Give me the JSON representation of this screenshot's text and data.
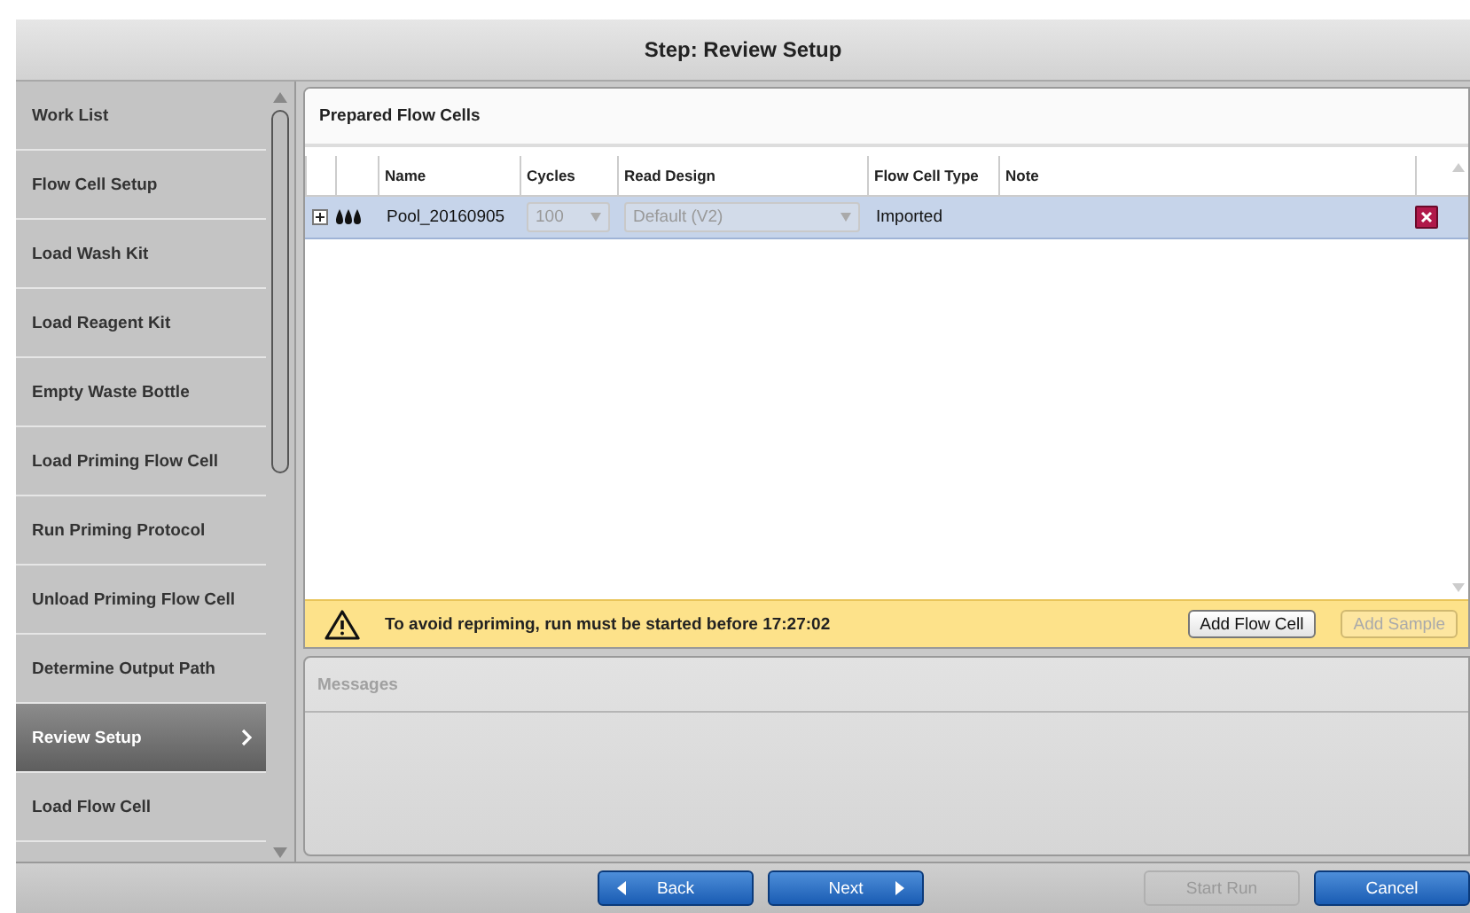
{
  "window": {
    "title": "Step: Review Setup"
  },
  "sidebar": {
    "items": [
      {
        "label": "Work List",
        "selected": false
      },
      {
        "label": "Flow Cell Setup",
        "selected": false
      },
      {
        "label": "Load Wash Kit",
        "selected": false
      },
      {
        "label": "Load Reagent Kit",
        "selected": false
      },
      {
        "label": "Empty Waste Bottle",
        "selected": false
      },
      {
        "label": "Load Priming Flow Cell",
        "selected": false
      },
      {
        "label": "Run Priming Protocol",
        "selected": false
      },
      {
        "label": "Unload Priming Flow Cell",
        "selected": false
      },
      {
        "label": "Determine Output Path",
        "selected": false
      },
      {
        "label": "Review Setup",
        "selected": true
      },
      {
        "label": "Load Flow Cell",
        "selected": false
      }
    ]
  },
  "panel": {
    "title": "Prepared Flow Cells",
    "table": {
      "columns": [
        "Name",
        "Cycles",
        "Read Design",
        "Flow Cell Type",
        "Note"
      ],
      "rows": [
        {
          "expanded": false,
          "selected": true,
          "name": "Pool_20160905",
          "cycles": "100",
          "read_design": "Default (V2)",
          "flow_cell_type": "Imported"
        }
      ]
    },
    "warning": "To avoid repriming, run must be started before 17:27:02",
    "buttons": [
      {
        "label": "Add Flow Cell",
        "disabled": false
      },
      {
        "label": "Add Sample",
        "disabled": true
      }
    ]
  },
  "messages": {
    "title": "Messages"
  },
  "footer": {
    "buttons": [
      {
        "label": "Back",
        "kind": "back",
        "disabled": false
      },
      {
        "label": "Next",
        "kind": "next",
        "disabled": false
      },
      {
        "label": "Start Run",
        "kind": "plain",
        "disabled": true
      },
      {
        "label": "Cancel",
        "kind": "plain",
        "disabled": false
      }
    ]
  }
}
